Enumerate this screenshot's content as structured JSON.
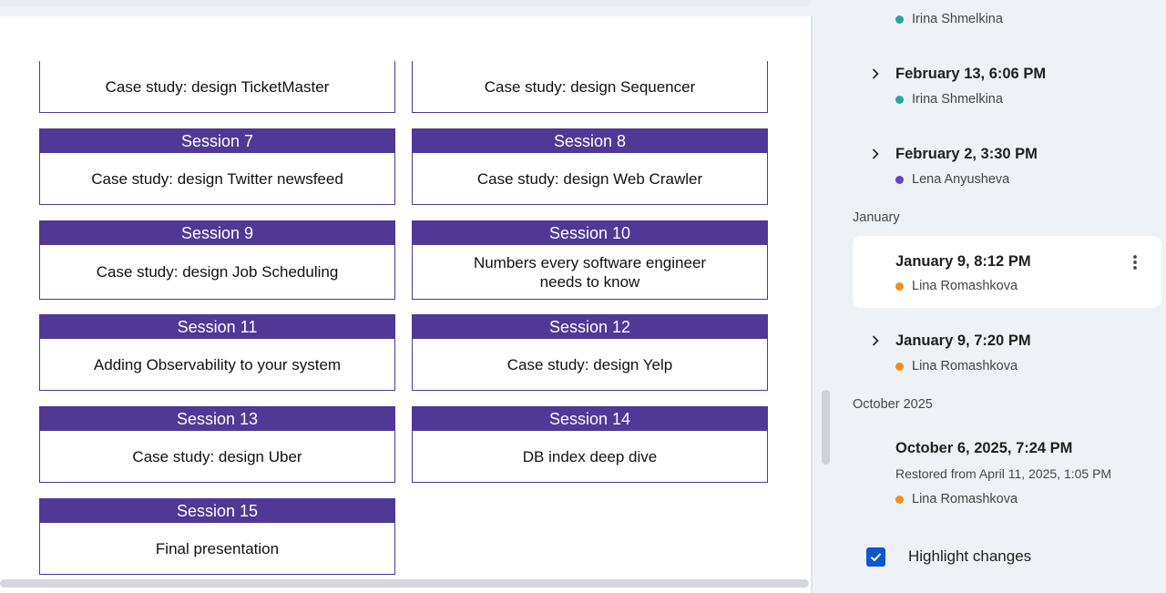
{
  "document": {
    "sessions": [
      {
        "header": "",
        "title": "Case study: design TicketMaster"
      },
      {
        "header": "",
        "title": "Case study: design Sequencer"
      },
      {
        "header": "Session 7",
        "title": "Case study: design Twitter newsfeed"
      },
      {
        "header": "Session 8",
        "title": "Case study: design Web Crawler"
      },
      {
        "header": "Session 9",
        "title": "Case study: design Job Scheduling"
      },
      {
        "header": "Session 10",
        "title_line1": "Numbers every software engineer",
        "title_line2": "needs to know"
      },
      {
        "header": "Session 11",
        "title": "Adding Observability to your system"
      },
      {
        "header": "Session 12",
        "title": "Case study: design Yelp"
      },
      {
        "header": "Session 13",
        "title": "Case study: design Uber"
      },
      {
        "header": "Session 14",
        "title": "DB index deep dive"
      },
      {
        "header": "Session 15",
        "title": "Final presentation"
      }
    ],
    "accent_color": "#4f3896"
  },
  "history": {
    "top_user": {
      "name": "Irina Shmelkina",
      "color": "#26a69a"
    },
    "versions": [
      {
        "title": "February 13, 6:06 PM",
        "user": "Irina Shmelkina",
        "color": "#26a69a"
      },
      {
        "title": "February 2, 3:30 PM",
        "user": "Lena Anyusheva",
        "color": "#6a3fc6"
      },
      {
        "title": "January 9, 8:12 PM",
        "user": "Lina Romashkova",
        "color": "#f28c1e"
      },
      {
        "title": "January 9, 7:20 PM",
        "user": "Lina Romashkova",
        "color": "#f28c1e"
      },
      {
        "title": "October 6, 2025, 7:24 PM",
        "subtitle": "Restored from April 11, 2025, 1:05 PM",
        "user": "Lina Romashkova",
        "color": "#f28c1e"
      }
    ],
    "groups": {
      "january": "January",
      "october": "October 2025"
    },
    "highlight_changes_label": "Highlight changes",
    "highlight_checked": true
  },
  "icons": {
    "expand": "chevron-right-icon",
    "more": "more-vert-icon",
    "check": "check-icon"
  }
}
